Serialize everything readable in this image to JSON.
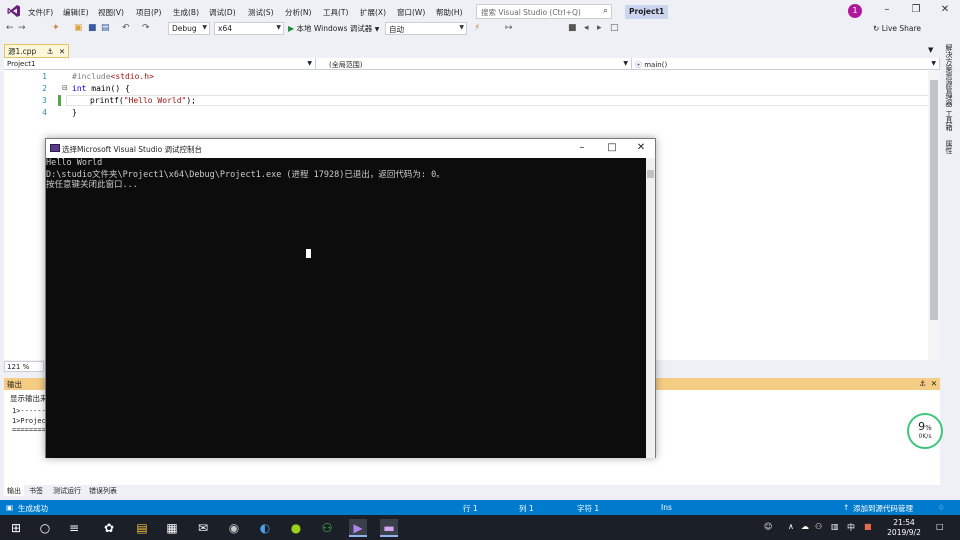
{
  "menu": {
    "items": [
      "文件(F)",
      "编辑(E)",
      "视图(V)",
      "项目(P)",
      "生成(B)",
      "调试(D)",
      "测试(S)",
      "分析(N)",
      "工具(T)",
      "扩展(X)",
      "窗口(W)",
      "帮助(H)"
    ],
    "search_placeholder": "搜索 Visual Studio (Ctrl+Q)",
    "solution_name": "Project1",
    "notification_count": "1"
  },
  "toolbar": {
    "configuration": "Debug",
    "platform": "x64",
    "run_label": "本地 Windows 调试器",
    "run_mode": "自动",
    "live_share": "Live Share"
  },
  "tabs": {
    "active_file": "源1.cpp"
  },
  "navbar": {
    "project": "Project1",
    "scope": "(全局范围)",
    "function": "main()"
  },
  "editor": {
    "lines": [
      {
        "num": "1",
        "pre": "#include",
        "arg": "<stdio.h>"
      },
      {
        "num": "2",
        "kw": "int",
        "rest": " main() {"
      },
      {
        "num": "3",
        "fn": "printf(",
        "str": "\"Hello World\"",
        "end": ");"
      },
      {
        "num": "4",
        "rest": "}"
      }
    ],
    "zoom": "121 %"
  },
  "right_strip": {
    "tabs": [
      "解决方案资源管理器",
      "工具箱",
      "属性"
    ]
  },
  "output": {
    "title": "输出",
    "source_label": "显示输出来",
    "lines": [
      "1>------",
      "1>Project",
      "========"
    ]
  },
  "bottom_tabs": [
    "输出",
    "书签",
    "测试运行",
    "错误列表"
  ],
  "statusbar": {
    "ready": "生成成功",
    "line": "行 1",
    "col": "列 1",
    "char": "字符 1",
    "ins": "Ins",
    "source_control": "添加到源代码管理"
  },
  "speed_widget": {
    "percent": "9",
    "percent_sign": "%",
    "rate": "0K/s"
  },
  "console": {
    "title": "选择Microsoft Visual Studio 调试控制台",
    "lines": [
      "Hello World",
      "D:\\studio文件夹\\Project1\\x64\\Debug\\Project1.exe (进程 17928)已退出，返回代码为: 0。",
      "按任意键关闭此窗口..."
    ]
  },
  "taskbar": {
    "ime": "中",
    "time": "21:54",
    "date": "2019/9/2"
  },
  "colors": {
    "statusbar": "#007acc",
    "output_header": "#f5cc84",
    "console_bg": "#0c0c0c",
    "keyword": "#0000ff",
    "string": "#a31515"
  }
}
